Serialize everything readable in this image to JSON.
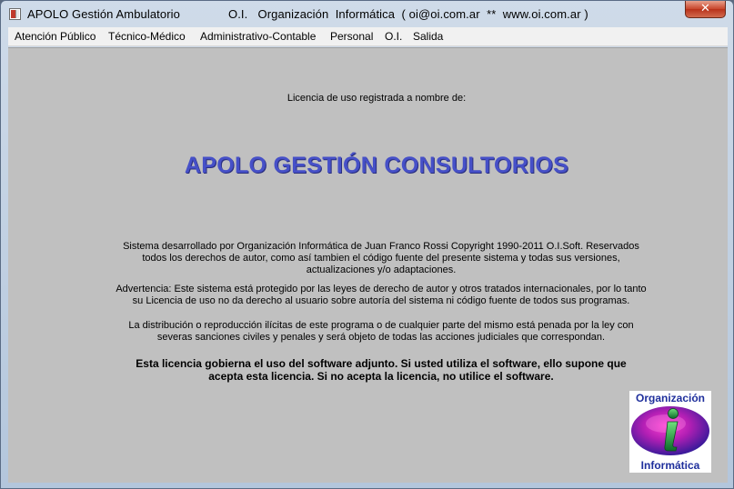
{
  "window": {
    "title": "APOLO Gestión Ambulatorio",
    "title_info": "O.I.   Organización  Informática  ( oi@oi.com.ar  **  www.oi.com.ar )",
    "close_label": "✕"
  },
  "menu": {
    "items": [
      {
        "label": "Atención Público"
      },
      {
        "label": "Técnico-Médico"
      },
      {
        "label": "Administrativo-Contable"
      },
      {
        "label": "Personal"
      },
      {
        "label": "O.I."
      },
      {
        "label": "Salida"
      }
    ]
  },
  "content": {
    "license_registered": "Licencia de uso registrada a nombre de:",
    "product_title": "APOLO GESTIÓN CONSULTORIOS",
    "para1": [
      "Sistema desarrollado por Organización Informática de Juan Franco Rossi   Copyright 1990-2011 O.I.Soft. Reservados",
      "todos los derechos de autor, como así tambien el código fuente del presente sistema y todas sus versiones,",
      "actualizaciones y/o adaptaciones."
    ],
    "para2": [
      "Advertencia: Este sistema está protegido por las leyes de derecho de autor y otros tratados internacionales, por lo tanto",
      "su Licencia de uso no da derecho al usuario sobre autoría del sistema ni código fuente de todos sus programas."
    ],
    "para3": [
      "La distribución o reproducción ilícitas de este programa o de cualquier parte del mismo está penada por la ley con",
      "severas sanciones civiles y penales y será objeto de todas las acciones judiciales que correspondan."
    ],
    "bold_para": [
      "Esta licencia gobierna el uso del software adjunto. Si usted utiliza el software, ello supone que",
      "acepta esta licencia. Si no acepta la licencia, no utilice el software."
    ]
  },
  "logo": {
    "top_text": "Organización",
    "bottom_text": "Informática",
    "letter": "i"
  },
  "colors": {
    "title_blue": "#4650c8",
    "logo_text": "#1f2f9c",
    "client_bg": "#c0c0c0"
  }
}
